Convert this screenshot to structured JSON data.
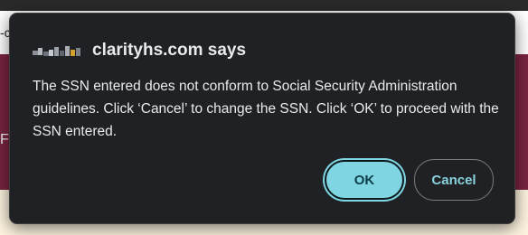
{
  "background": {
    "strip_text": "-c",
    "band_text": "F"
  },
  "dialog": {
    "site_favicon": "pixelated-site-logo",
    "title": "clarityhs.com says",
    "message": "The SSN entered does not conform to Social Security Administration guidelines. Click ‘Cancel’ to change the SSN. Click ‘OK’ to proceed with the SSN entered.",
    "ok_label": "OK",
    "cancel_label": "Cancel"
  },
  "colors": {
    "dialog_bg": "#202124",
    "ok_bg": "#7fd6e2",
    "cancel_text": "#8ad2de",
    "page_band": "#7a2440"
  }
}
